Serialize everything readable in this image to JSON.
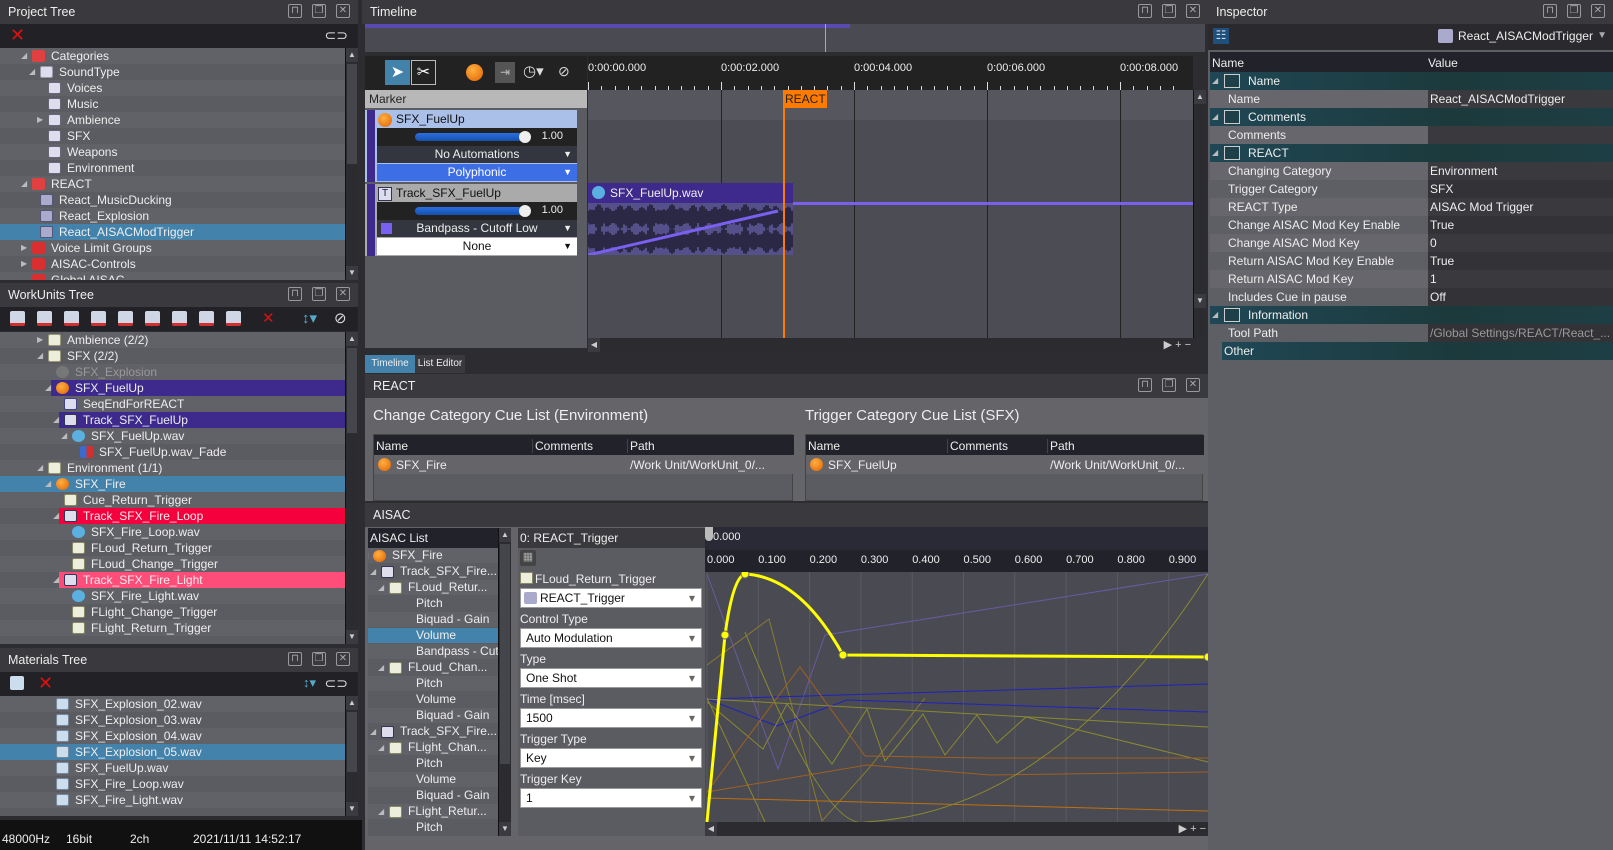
{
  "project_tree": {
    "title": "Project Tree",
    "items": [
      {
        "label": "Categories",
        "depth": 0,
        "icon": "folder-open-icon",
        "toggle": "open"
      },
      {
        "label": "SoundType",
        "depth": 1,
        "icon": "category-group-icon",
        "toggle": "open"
      },
      {
        "label": "Voices",
        "depth": 2,
        "icon": "category-icon"
      },
      {
        "label": "Music",
        "depth": 2,
        "icon": "category-icon"
      },
      {
        "label": "Ambience",
        "depth": 2,
        "icon": "category-icon",
        "toggle": "closed"
      },
      {
        "label": "SFX",
        "depth": 2,
        "icon": "category-icon"
      },
      {
        "label": "Weapons",
        "depth": 2,
        "icon": "category-icon"
      },
      {
        "label": "Environment",
        "depth": 2,
        "icon": "category-icon"
      },
      {
        "label": "REACT",
        "depth": 0,
        "icon": "folder-open-icon",
        "toggle": "open"
      },
      {
        "label": "React_MusicDucking",
        "depth": 1,
        "icon": "react-icon"
      },
      {
        "label": "React_Explosion",
        "depth": 1,
        "icon": "react-icon"
      },
      {
        "label": "React_AISACModTrigger",
        "depth": 1,
        "icon": "react-icon",
        "state": "selected"
      },
      {
        "label": "Voice Limit Groups",
        "depth": 0,
        "icon": "folder-icon",
        "toggle": "closed"
      },
      {
        "label": "AISAC-Controls",
        "depth": 0,
        "icon": "folder-icon",
        "toggle": "closed"
      },
      {
        "label": "Global AISAC-",
        "depth": 0,
        "icon": "folder-icon"
      }
    ]
  },
  "workunits_tree": {
    "title": "WorkUnits Tree",
    "items": [
      {
        "label": "Ambience (2/2)",
        "depth": 2,
        "icon": "cuesheet-icon",
        "toggle": "closed"
      },
      {
        "label": "SFX (2/2)",
        "depth": 2,
        "icon": "cuesheet-icon",
        "toggle": "open"
      },
      {
        "label": "SFX_Explosion",
        "depth": 3,
        "icon": "cue-disabled-icon",
        "toggle": "closed",
        "state": "disabled"
      },
      {
        "label": "SFX_FuelUp",
        "depth": 3,
        "icon": "cue-icon",
        "toggle": "open",
        "state": "purple"
      },
      {
        "label": "SeqEndForREACT",
        "depth": 4,
        "icon": "marker-icon"
      },
      {
        "label": "Track_SFX_FuelUp",
        "depth": 4,
        "icon": "track-icon",
        "toggle": "open",
        "state": "purple"
      },
      {
        "label": "SFX_FuelUp.wav",
        "depth": 5,
        "icon": "waveform-icon",
        "toggle": "open"
      },
      {
        "label": "SFX_FuelUp.wav_Fade",
        "depth": 6,
        "icon": "fade-icon"
      },
      {
        "label": "Environment (1/1)",
        "depth": 2,
        "icon": "cuesheet-icon",
        "toggle": "open"
      },
      {
        "label": "SFX_Fire",
        "depth": 3,
        "icon": "cue-icon",
        "toggle": "open",
        "state": "selected"
      },
      {
        "label": "Cue_Return_Trigger",
        "depth": 4,
        "icon": "aisac-icon"
      },
      {
        "label": "Track_SFX_Fire_Loop",
        "depth": 4,
        "icon": "track-icon",
        "toggle": "open",
        "state": "red"
      },
      {
        "label": "SFX_Fire_Loop.wav",
        "depth": 5,
        "icon": "waveform-icon"
      },
      {
        "label": "FLoud_Return_Trigger",
        "depth": 5,
        "icon": "aisac-icon"
      },
      {
        "label": "FLoud_Change_Trigger",
        "depth": 5,
        "icon": "aisac-icon"
      },
      {
        "label": "Track_SFX_Fire_Light",
        "depth": 4,
        "icon": "track-icon",
        "toggle": "open",
        "state": "pink"
      },
      {
        "label": "SFX_Fire_Light.wav",
        "depth": 5,
        "icon": "waveform-icon"
      },
      {
        "label": "FLight_Change_Trigger",
        "depth": 5,
        "icon": "aisac-icon"
      },
      {
        "label": "FLight_Return_Trigger",
        "depth": 5,
        "icon": "aisac-icon"
      }
    ]
  },
  "materials_tree": {
    "title": "Materials Tree",
    "items": [
      {
        "label": "SFX_Explosion_02.wav",
        "depth": 3,
        "icon": "audio-file-icon"
      },
      {
        "label": "SFX_Explosion_03.wav",
        "depth": 3,
        "icon": "audio-file-icon"
      },
      {
        "label": "SFX_Explosion_04.wav",
        "depth": 3,
        "icon": "audio-file-icon"
      },
      {
        "label": "SFX_Explosion_05.wav",
        "depth": 3,
        "icon": "audio-file-icon",
        "state": "selected"
      },
      {
        "label": "SFX_FuelUp.wav",
        "depth": 3,
        "icon": "audio-file-icon"
      },
      {
        "label": "SFX_Fire_Loop.wav",
        "depth": 3,
        "icon": "audio-file-icon"
      },
      {
        "label": "SFX_Fire_Light.wav",
        "depth": 3,
        "icon": "audio-file-icon"
      }
    ]
  },
  "status_bar": {
    "rate": "48000Hz",
    "bits": "16bit",
    "channels": "2ch",
    "datetime": "2021/11/11 14:52:17"
  },
  "timeline": {
    "title": "Timeline",
    "marker_label": "Marker",
    "cue": {
      "name": "SFX_FuelUp",
      "volume": "1.00",
      "automation": "No Automations",
      "mode": "Polyphonic"
    },
    "track": {
      "name": "Track_SFX_FuelUp",
      "volume": "1.00",
      "automation": "Bandpass - Cutoff Low",
      "extra": "None"
    },
    "ticks": [
      "0:00:00.000",
      "0:00:02.000",
      "0:00:04.000",
      "0:00:06.000",
      "0:00:08.000"
    ],
    "marker": "REACT",
    "clip": "SFX_FuelUp.wav",
    "tabs": [
      "Timeline",
      "List Editor"
    ],
    "active_tab": "Timeline"
  },
  "react_panel": {
    "title": "REACT",
    "change_list": {
      "title": "Change Category Cue List (Environment)",
      "columns": [
        "Name",
        "Comments",
        "Path"
      ],
      "rows": [
        {
          "name": "SFX_Fire",
          "comments": "",
          "path": "/Work Unit/WorkUnit_0/..."
        }
      ]
    },
    "trigger_list": {
      "title": "Trigger Category Cue List (SFX)",
      "columns": [
        "Name",
        "Comments",
        "Path"
      ],
      "rows": [
        {
          "name": "SFX_FuelUp",
          "comments": "",
          "path": "/Work Unit/WorkUnit_0/..."
        }
      ]
    }
  },
  "aisac": {
    "title": "AISAC",
    "list_title": "AISAC List",
    "items": [
      {
        "label": "SFX_Fire",
        "depth": 0,
        "icon": "cue-icon",
        "toggle": "open"
      },
      {
        "label": "Track_SFX_Fire...",
        "depth": 1,
        "icon": "track-icon",
        "toggle": "open"
      },
      {
        "label": "FLoud_Retur...",
        "depth": 2,
        "icon": "aisac-icon",
        "toggle": "open"
      },
      {
        "label": "Pitch",
        "depth": 3
      },
      {
        "label": "Biquad - Gain",
        "depth": 3
      },
      {
        "label": "Volume",
        "depth": 3,
        "state": "selected"
      },
      {
        "label": "Bandpass - Cut...",
        "depth": 3
      },
      {
        "label": "FLoud_Chan...",
        "depth": 2,
        "icon": "aisac-icon",
        "toggle": "open"
      },
      {
        "label": "Pitch",
        "depth": 3
      },
      {
        "label": "Volume",
        "depth": 3
      },
      {
        "label": "Biquad - Gain",
        "depth": 3
      },
      {
        "label": "Track_SFX_Fire...",
        "depth": 1,
        "icon": "track-icon",
        "toggle": "open"
      },
      {
        "label": "FLight_Chan...",
        "depth": 2,
        "icon": "aisac-icon",
        "toggle": "open"
      },
      {
        "label": "Pitch",
        "depth": 3
      },
      {
        "label": "Volume",
        "depth": 3
      },
      {
        "label": "Biquad - Gain",
        "depth": 3
      },
      {
        "label": "FLight_Retur...",
        "depth": 2,
        "icon": "aisac-icon",
        "toggle": "open"
      },
      {
        "label": "Pitch",
        "depth": 3
      }
    ],
    "control_header": "0: REACT_Trigger",
    "cursor_value": "0.000",
    "aisac_name": "FLoud_Return_Trigger",
    "control": "REACT_Trigger",
    "control_type_label": "Control Type",
    "control_type": "Auto Modulation",
    "type_label": "Type",
    "type": "One Shot",
    "time_label": "Time [msec]",
    "time": "1500",
    "trigger_type_label": "Trigger Type",
    "trigger_type": "Key",
    "trigger_key_label": "Trigger Key",
    "trigger_key": "1",
    "x_ticks": [
      "0.000",
      "0.100",
      "0.200",
      "0.300",
      "0.400",
      "0.500",
      "0.600",
      "0.700",
      "0.800",
      "0.900"
    ],
    "curve_color": "#ffff00"
  },
  "inspector": {
    "title": "Inspector",
    "object": "React_AISACModTrigger",
    "col_name": "Name",
    "col_value": "Value",
    "rows": [
      {
        "type": "group",
        "label": "Name",
        "icon": "name-icon"
      },
      {
        "label": "Name",
        "value": "React_AISACModTrigger"
      },
      {
        "type": "group",
        "label": "Comments",
        "icon": "comments-icon"
      },
      {
        "label": "Comments",
        "value": ""
      },
      {
        "type": "group",
        "label": "REACT",
        "icon": "react-icon"
      },
      {
        "label": "Changing Category",
        "value": "Environment"
      },
      {
        "label": "Trigger Category",
        "value": "SFX"
      },
      {
        "label": "REACT Type",
        "value": "AISAC Mod Trigger"
      },
      {
        "label": "Change AISAC Mod Key Enable",
        "value": "True"
      },
      {
        "label": "Change AISAC Mod Key",
        "value": "0"
      },
      {
        "label": "Return AISAC Mod Key Enable",
        "value": "True"
      },
      {
        "label": "Return AISAC Mod Key",
        "value": "1"
      },
      {
        "label": "Includes Cue in pause",
        "value": "Off"
      },
      {
        "type": "group",
        "label": "Information",
        "icon": "info-icon"
      },
      {
        "label": "Tool Path",
        "value": "/Global Settings/REACT/React_...",
        "dim": true
      },
      {
        "type": "group",
        "label": "Other",
        "noicon": true
      }
    ]
  },
  "colors": {
    "selected": "#4382ab",
    "purple": "#3d2a8c",
    "red": "#f5003c",
    "pink": "#ff4d79",
    "marker": "#ff7a00",
    "group": "#1f4755"
  }
}
